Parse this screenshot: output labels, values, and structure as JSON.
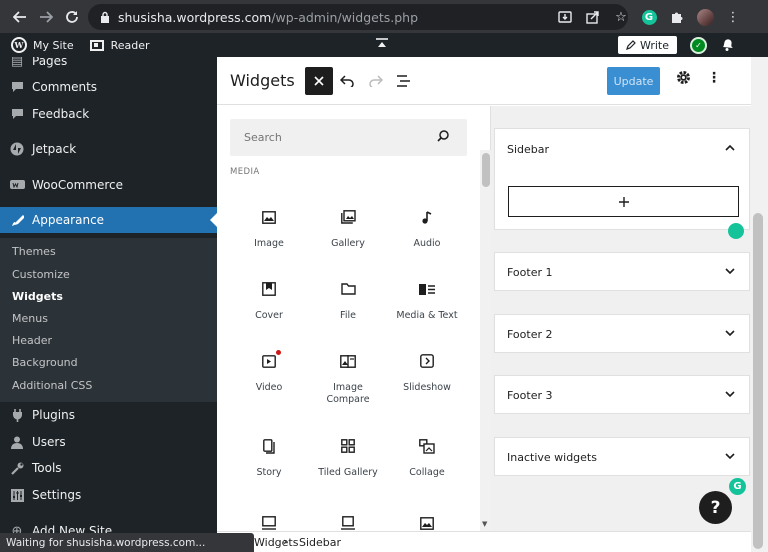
{
  "browser": {
    "url_host": "shusisha.wordpress.com",
    "url_path": "/wp-admin/widgets.php",
    "status_text": "Waiting for shusisha.wordpress.com..."
  },
  "adminbar": {
    "my_site": "My Site",
    "reader": "Reader",
    "write": "Write"
  },
  "sidebar": {
    "items": [
      {
        "label": "Pages",
        "icon": "pages-icon"
      },
      {
        "label": "Comments",
        "icon": "comments-icon"
      },
      {
        "label": "Feedback",
        "icon": "feedback-icon"
      },
      {
        "label": "Jetpack",
        "icon": "jetpack-icon"
      },
      {
        "label": "WooCommerce",
        "icon": "woocommerce-icon"
      },
      {
        "label": "Appearance",
        "icon": "appearance-icon"
      },
      {
        "label": "Plugins",
        "icon": "plugins-icon"
      },
      {
        "label": "Users",
        "icon": "users-icon"
      },
      {
        "label": "Tools",
        "icon": "tools-icon"
      },
      {
        "label": "Settings",
        "icon": "settings-icon"
      },
      {
        "label": "Add New Site",
        "icon": "add-site-icon"
      }
    ],
    "submenu": [
      "Themes",
      "Customize",
      "Widgets",
      "Menus",
      "Header",
      "Background",
      "Additional CSS"
    ]
  },
  "editor": {
    "title": "Widgets",
    "update_label": "Update",
    "search_placeholder": "Search",
    "category": "MEDIA",
    "blocks": [
      "Image",
      "Gallery",
      "Audio",
      "Cover",
      "File",
      "Media & Text",
      "Video",
      "Image Compare",
      "Slideshow",
      "Story",
      "Tiled Gallery",
      "Collage"
    ],
    "areas": [
      "Sidebar",
      "Footer 1",
      "Footer 2",
      "Footer 3",
      "Inactive widgets"
    ],
    "breadcrumb": [
      "Widgets",
      "Sidebar"
    ]
  },
  "colors": {
    "accent": "#2271b1",
    "update_button": "#3a8fd2",
    "grammarly": "#15c39a"
  }
}
